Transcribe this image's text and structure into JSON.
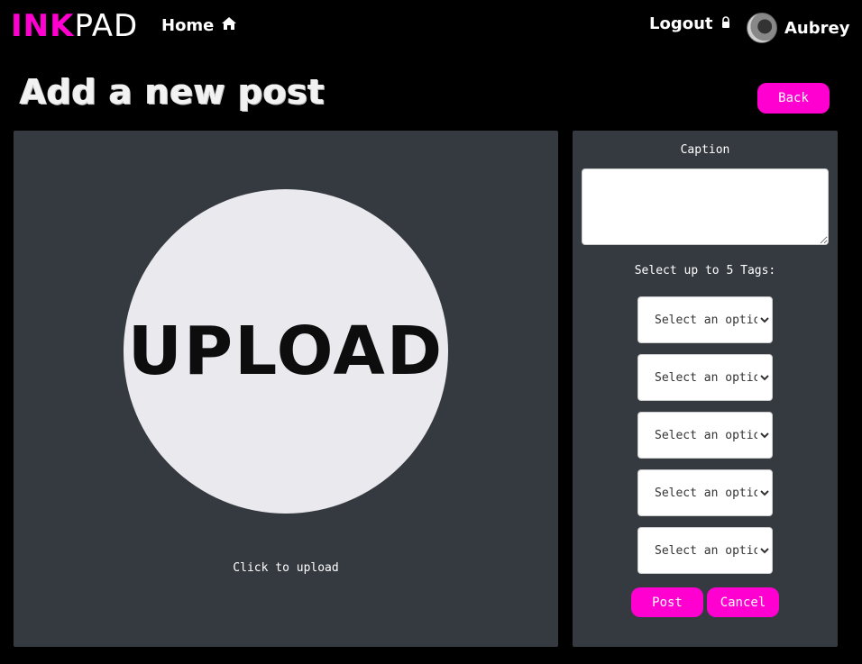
{
  "nav": {
    "logo_ink": "INK",
    "logo_pad": "PAD",
    "home_label": "Home",
    "logout_label": "Logout",
    "user_name": "Aubrey"
  },
  "page": {
    "title": "Add a new post",
    "back_label": "Back"
  },
  "upload": {
    "image_text": "UPLOAD",
    "caption": "Click to upload"
  },
  "form": {
    "caption_label": "Caption",
    "caption_value": "",
    "tags_label": "Select up to 5 Tags:",
    "tag_selects": [
      "Select an option",
      "Select an option",
      "Select an option",
      "Select an option",
      "Select an option"
    ],
    "post_label": "Post",
    "cancel_label": "Cancel"
  },
  "colors": {
    "accent": "#ff00d0",
    "panel": "#353a40",
    "background": "#000000"
  },
  "icons": {
    "home": "home-icon",
    "logout": "lock-icon"
  }
}
